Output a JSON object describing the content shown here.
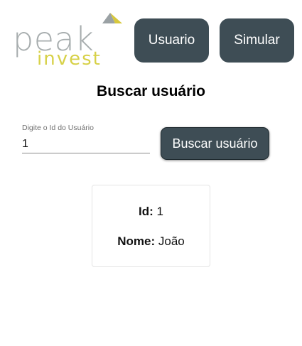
{
  "logo": {
    "word1": "peak",
    "word2": "invest",
    "colors": {
      "peak": "#a7adae",
      "invest": "#d7d148",
      "mark_gold": "#d7c83c",
      "mark_gray": "#9aa1a4"
    }
  },
  "nav": {
    "usuario_label": "Usuario",
    "simular_label": "Simular"
  },
  "title": "Buscar usuário",
  "search": {
    "label": "Digite o Id do Usuário",
    "value": "1",
    "button_label": "Buscar usuário"
  },
  "result": {
    "id_label": "Id:",
    "id_value": "1",
    "name_label": "Nome:",
    "name_value": "João"
  },
  "colors": {
    "button_bg": "#3e4d55",
    "button_text": "#ffffff"
  }
}
